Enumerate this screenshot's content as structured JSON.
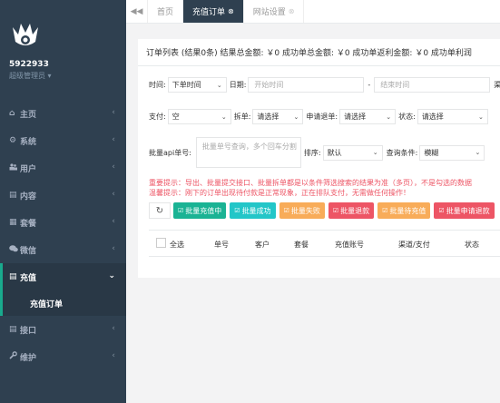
{
  "sidebar": {
    "username": "5922933",
    "role": "超级管理员 ▾",
    "items": [
      {
        "icon": "home-icon",
        "glyph": "⌂",
        "label": "主页"
      },
      {
        "icon": "gear-icon",
        "glyph": "⚙",
        "label": "系统"
      },
      {
        "icon": "users-icon",
        "glyph": "👥",
        "label": "用户"
      },
      {
        "icon": "file-icon",
        "glyph": "▤",
        "label": "内容"
      },
      {
        "icon": "list-icon",
        "glyph": "▦",
        "label": "套餐"
      },
      {
        "icon": "chat-icon",
        "glyph": "💬",
        "label": "微信"
      },
      {
        "icon": "file-icon",
        "glyph": "▤",
        "label": "充值"
      },
      {
        "icon": "file-icon",
        "glyph": "▤",
        "label": "接口"
      },
      {
        "icon": "wrench-icon",
        "glyph": "🔧",
        "label": "维护"
      }
    ],
    "sub_item": "充值订单"
  },
  "tabs": {
    "back": "◀◀",
    "items": [
      {
        "label": "首页"
      },
      {
        "label": "充值订单",
        "close": "⊗"
      },
      {
        "label": "网站设置",
        "close": "⊗"
      }
    ]
  },
  "summary": "订单列表 (结果0条)   结果总金额: ￥0  成功单总金额: ￥0  成功单返利金额: ￥0  成功单利润",
  "filters": {
    "time_label": "时间:",
    "time_select": "下单时间",
    "date_label": "日期:",
    "start_placeholder": "开始时间",
    "dash": "-",
    "end_placeholder": "结束时间",
    "channel_label": "渠",
    "pay_label": "支付:",
    "pay_value": "空",
    "split_label": "拆单:",
    "split_value": "请选择",
    "refund_label": "申请退单:",
    "refund_value": "请选择",
    "status_label": "状态:",
    "status_value": "请选择",
    "api_label": "批量api单号:",
    "api_placeholder": "批量单号查询，多个回车分割",
    "sort_label": "排序:",
    "sort_value": "默认",
    "cond_label": "查询条件:",
    "cond_value": "模糊"
  },
  "warnings": [
    "重要提示：导出、批量提交接口、批量拆单都是以条件筛选搜索的结果为准（多页），不是勾选的数据",
    "温馨提示：刚下的订单出现待付款是正常现象，正在排队支付，无需做任何操作！"
  ],
  "buttons": [
    {
      "label": "批量充值中",
      "color": "#1ab394"
    },
    {
      "label": "批量成功",
      "color": "#23c6c8"
    },
    {
      "label": "批量失败",
      "color": "#f8ac59"
    },
    {
      "label": "批量退款",
      "color": "#ed5565"
    },
    {
      "label": "批量待充值",
      "color": "#f8ac59"
    },
    {
      "label": "批量申请退款",
      "color": "#ed5565"
    }
  ],
  "table": {
    "headers": [
      "全选",
      "单号",
      "客户",
      "套餐",
      "充值账号",
      "渠道/支付",
      "状态"
    ]
  },
  "colors": {
    "sidebar_bg": "#2f4050",
    "accent": "#1ab394",
    "danger": "#ed5565"
  }
}
